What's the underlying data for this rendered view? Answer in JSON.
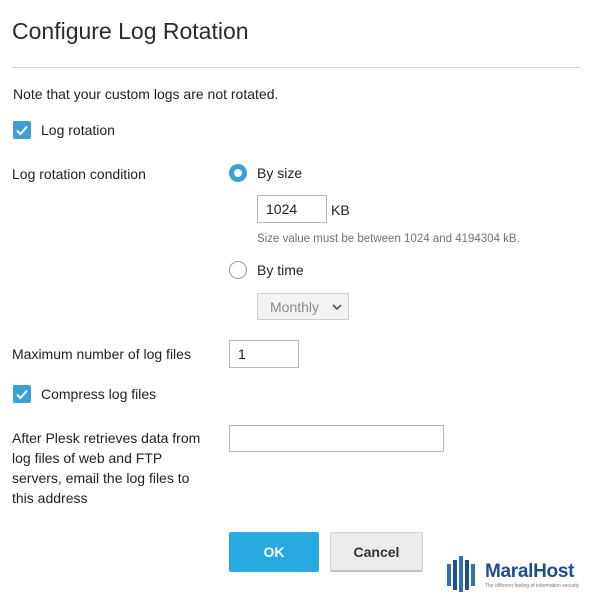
{
  "dialog": {
    "title": "Configure Log Rotation",
    "note": "Note that your custom logs are not rotated.",
    "log_rotation": {
      "label": "Log rotation",
      "checked": true
    },
    "condition": {
      "label": "Log rotation condition",
      "by_size": {
        "label": "By size",
        "selected": true
      },
      "size_value": "1024",
      "size_unit": "KB",
      "size_hint": "Size value must be between 1024 and 4194304 kB.",
      "by_time": {
        "label": "By time",
        "selected": false
      },
      "time_selected": "Monthly"
    },
    "max_files": {
      "label": "Maximum number of log files",
      "value": "1"
    },
    "compress": {
      "label": "Compress log files",
      "checked": true
    },
    "email": {
      "label_lines": [
        "After Plesk retrieves data from",
        "log files of web and FTP",
        "servers, email the log files to",
        "this address"
      ],
      "value": ""
    },
    "buttons": {
      "ok": "OK",
      "cancel": "Cancel"
    }
  },
  "watermark": {
    "brand": "MaralHost",
    "tagline": "The different feeling of information security"
  },
  "colors": {
    "accent": "#3ba0d6",
    "ok_button": "#28aae1",
    "logo": "#1f4e8c"
  }
}
